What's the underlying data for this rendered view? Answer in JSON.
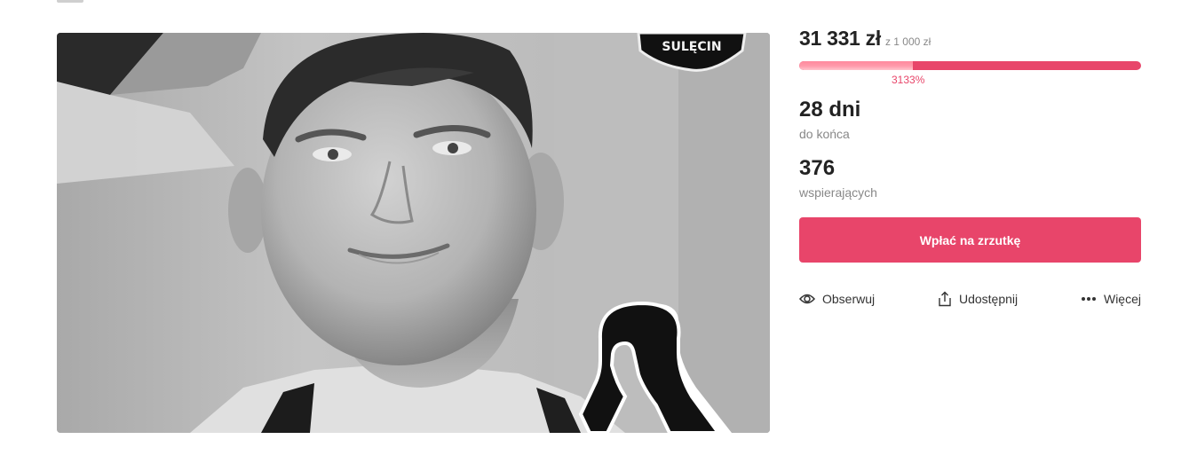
{
  "campaign": {
    "raised": "31 331 zł",
    "goal": "z 1 000 zł",
    "progress_fraction": 1.0,
    "percent_label": "3133%",
    "days_value": "28 dni",
    "days_label": "do końca",
    "supporters_value": "376",
    "supporters_label": "wspierających"
  },
  "cta_label": "Wpłać na zrzutkę",
  "actions": {
    "follow": "Obserwuj",
    "share": "Udostępnij",
    "more": "Więcej"
  },
  "photo": {
    "badge_text": "SULĘCIN",
    "icons": [
      "eye-icon",
      "share-icon",
      "more-dots-icon",
      "mourning-ribbon"
    ]
  },
  "colors": {
    "accent": "#e8456a",
    "progress_light": "#ff9aab",
    "muted_text": "#888888"
  }
}
